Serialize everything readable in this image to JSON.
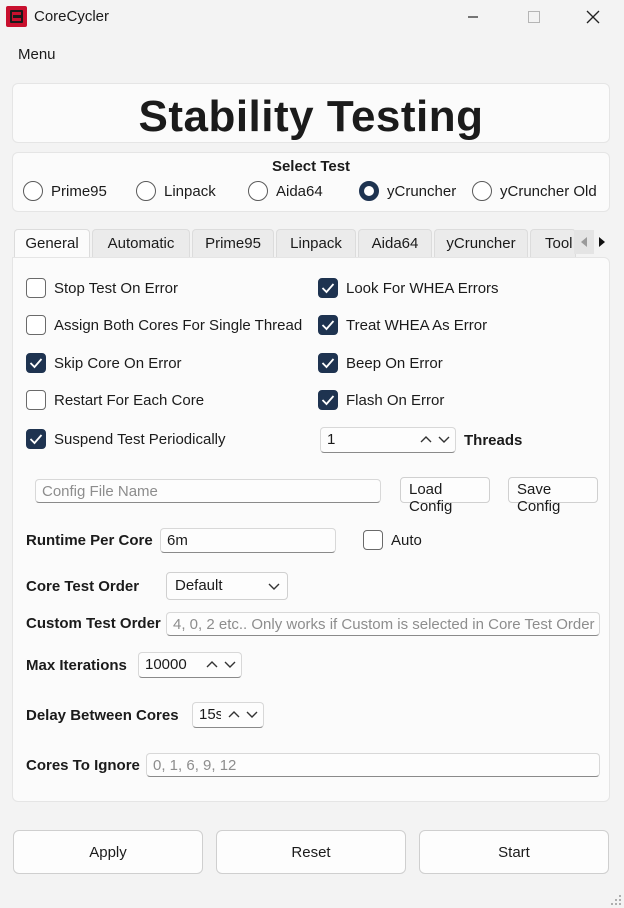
{
  "window": {
    "title": "CoreCycler",
    "minimize_icon": "minimize-icon",
    "maximize_icon": "maximize-icon",
    "close_icon": "close-icon"
  },
  "menubar": {
    "menu_label": "Menu"
  },
  "header": {
    "title": "Stability Testing"
  },
  "select_test": {
    "title": "Select Test",
    "options": [
      {
        "label": "Prime95",
        "selected": false
      },
      {
        "label": "Linpack",
        "selected": false
      },
      {
        "label": "Aida64",
        "selected": false
      },
      {
        "label": "yCruncher",
        "selected": true
      },
      {
        "label": "yCruncher Old",
        "selected": false
      }
    ]
  },
  "tabs": [
    {
      "label": "General",
      "active": true
    },
    {
      "label": "Automatic",
      "active": false
    },
    {
      "label": "Prime95",
      "active": false
    },
    {
      "label": "Linpack",
      "active": false
    },
    {
      "label": "Aida64",
      "active": false
    },
    {
      "label": "yCruncher",
      "active": false
    },
    {
      "label": "Tool",
      "active": false
    }
  ],
  "general": {
    "left_options": [
      {
        "label": "Stop Test On Error",
        "checked": false
      },
      {
        "label": "Assign Both Cores For Single Thread",
        "checked": false
      },
      {
        "label": "Skip Core On Error",
        "checked": true
      },
      {
        "label": "Restart For Each Core",
        "checked": false
      },
      {
        "label": "Suspend Test Periodically",
        "checked": true
      }
    ],
    "right_options": [
      {
        "label": "Look For WHEA Errors",
        "checked": true
      },
      {
        "label": "Treat WHEA As Error",
        "checked": true
      },
      {
        "label": "Beep On Error",
        "checked": true
      },
      {
        "label": "Flash On Error",
        "checked": true
      }
    ],
    "threads": {
      "value": "1",
      "label": "Threads"
    },
    "config": {
      "file_placeholder": "Config File Name",
      "load_label": "Load Config",
      "save_label": "Save Config"
    },
    "runtime": {
      "label": "Runtime Per Core",
      "value": "6m",
      "auto_label": "Auto",
      "auto_checked": false
    },
    "core_test_order": {
      "label": "Core Test Order",
      "value": "Default"
    },
    "custom_test_order": {
      "label": "Custom Test Order",
      "placeholder": "4, 0, 2 etc.. Only works if Custom is selected in Core Test Order"
    },
    "max_iterations": {
      "label": "Max Iterations",
      "value": "10000"
    },
    "delay_between_cores": {
      "label": "Delay Between Cores",
      "value": "15s"
    },
    "cores_to_ignore": {
      "label": "Cores To Ignore",
      "placeholder": "0, 1, 6, 9, 12"
    }
  },
  "footer": {
    "apply_label": "Apply",
    "reset_label": "Reset",
    "start_label": "Start"
  },
  "colors": {
    "accent": "#1e3350",
    "app_icon": "#c8102e"
  }
}
